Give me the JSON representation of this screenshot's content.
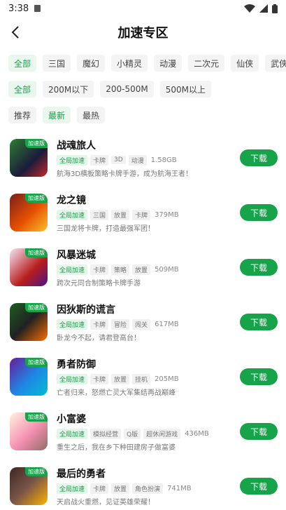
{
  "status": {
    "time": "3:38"
  },
  "header": {
    "title": "加速专区"
  },
  "filters": {
    "genres": [
      "全部",
      "三国",
      "魔幻",
      "小精灵",
      "动漫",
      "二次元",
      "仙侠",
      "武侠"
    ],
    "sizes": [
      "全部",
      "200M以下",
      "200-500M",
      "500M以上"
    ],
    "sorts": [
      "推荐",
      "最新",
      "最热"
    ]
  },
  "badge_label": "加速版",
  "download_label": "下载",
  "games": [
    {
      "name": "战魂旅人",
      "tags": [
        "全局加速",
        "卡牌",
        "3D",
        "动漫"
      ],
      "size": "1.58GB",
      "desc": "航海3D横板策略卡牌手游，成为航海王者！"
    },
    {
      "name": "龙之镜",
      "tags": [
        "全局加速",
        "三国",
        "放置",
        "卡牌"
      ],
      "size": "379MB",
      "desc": "三国龙将卡牌，打造最强军团！"
    },
    {
      "name": "风暴迷城",
      "tags": [
        "全局加速",
        "卡牌",
        "策略",
        "放置"
      ],
      "size": "509MB",
      "desc": "跨次元同合制策略卡牌手游"
    },
    {
      "name": "因狄斯的谎言",
      "tags": [
        "全局加速",
        "卡牌",
        "冒险",
        "闯关"
      ],
      "size": "617MB",
      "desc": "卧龙今不起，请君登高台！"
    },
    {
      "name": "勇者防御",
      "tags": [
        "全局加速",
        "卡牌",
        "放置",
        "挂机"
      ],
      "size": "205MB",
      "desc": "亡者归来，怒燃亡灵大军集结再战巅峰"
    },
    {
      "name": "小富婆",
      "tags": [
        "全局加速",
        "模拟经营",
        "Q版",
        "超休闲游戏"
      ],
      "size": "436MB",
      "desc": "重生之后，我在乡下种田建房子做富婆"
    },
    {
      "name": "最后的勇者",
      "tags": [
        "全局加速",
        "卡牌",
        "放置",
        "角色扮演"
      ],
      "size": "741MB",
      "desc": "天启战火重燃，见证英雄荣耀！"
    }
  ],
  "colors": {
    "accent": "#16a34a",
    "accent_bg": "#eaf7ef"
  }
}
